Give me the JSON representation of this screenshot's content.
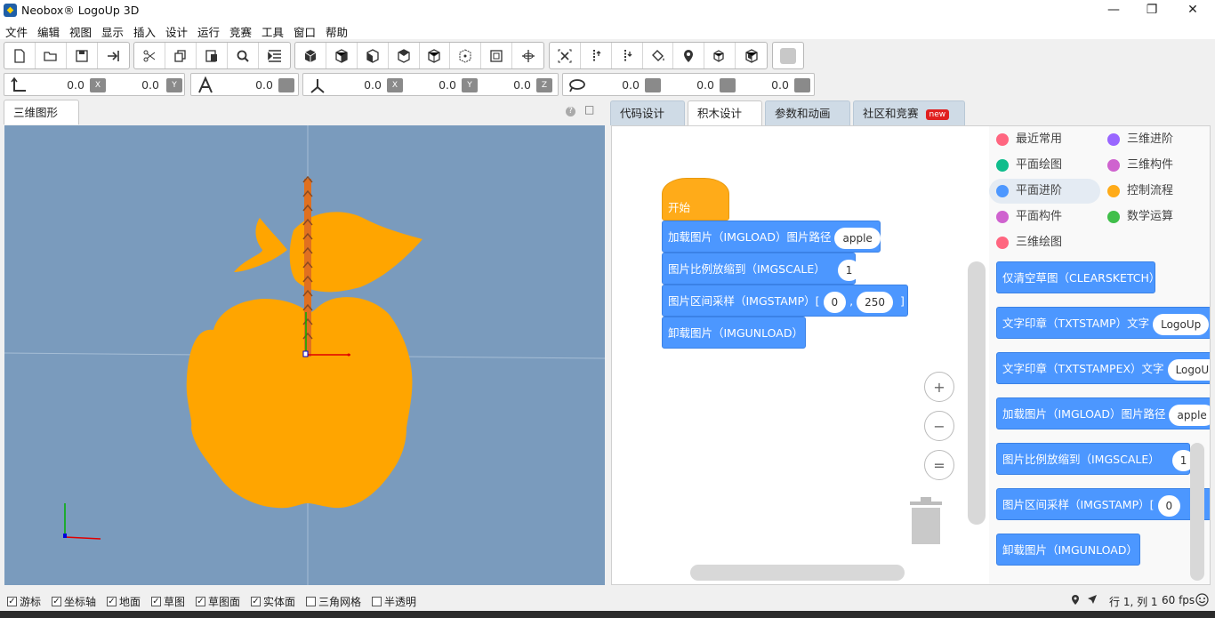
{
  "window": {
    "title": "Neobox® LogoUp 3D",
    "minimize": "—",
    "maximize": "❐",
    "close": "✕"
  },
  "menu": [
    "文件",
    "编辑",
    "视图",
    "显示",
    "插入",
    "设计",
    "运行",
    "竞赛",
    "工具",
    "窗口",
    "帮助"
  ],
  "coords": {
    "pos_x": "0.0",
    "pos_y": "0.0",
    "angle": "0.0",
    "rot_x": "0.0",
    "rot_y": "0.0",
    "rot_z": "0.0",
    "s1": "0.0",
    "s2": "0.0",
    "s3": "0.0"
  },
  "coord_icon_labels": {
    "x": "X",
    "y": "Y",
    "z": "Z"
  },
  "left_tab": "三维图形",
  "left_tab_help": "?",
  "left_tab_max": "□",
  "right_tabs": [
    "代码设计",
    "积木设计",
    "参数和动画",
    "社区和竞赛"
  ],
  "new_badge": "new",
  "workspace_blocks": {
    "start": "开始",
    "imgload": "加载图片（IMGLOAD）图片路径",
    "imgload_val": "apple",
    "imgscale": "图片比例放缩到（IMGSCALE）",
    "imgscale_val": "1",
    "imgstamp": "图片区间采样（IMGSTAMP）[",
    "imgstamp_v1": "0",
    "imgstamp_comma": ",",
    "imgstamp_v2": "250",
    "imgstamp_end": "]",
    "imgunload": "卸载图片（IMGUNLOAD）"
  },
  "categories": [
    {
      "label": "最近常用",
      "color": "#ff6680"
    },
    {
      "label": "三维进阶",
      "color": "#9966ff"
    },
    {
      "label": "平面绘图",
      "color": "#0fbd8c"
    },
    {
      "label": "三维构件",
      "color": "#cf63cf"
    },
    {
      "label": "平面进阶",
      "color": "#4c97ff"
    },
    {
      "label": "控制流程",
      "color": "#ffab19"
    },
    {
      "label": "平面构件",
      "color": "#cf63cf"
    },
    {
      "label": "数学运算",
      "color": "#40bf4a"
    },
    {
      "label": "三维绘图",
      "color": "#ff6680"
    }
  ],
  "palette_blocks": {
    "clearsketch": "仅清空草图（CLEARSKETCH）",
    "txtstamp": "文字印章（TXTSTAMP）文字",
    "txtstamp_val": "LogoUp",
    "txtstampex": "文字印章（TXTSTAMPEX）文字",
    "txtstampex_val": "LogoUp",
    "imgload": "加载图片（IMGLOAD）图片路径",
    "imgload_val": "apple",
    "imgscale": "图片比例放缩到（IMGSCALE）",
    "imgscale_val": "1",
    "imgstamp": "图片区间采样（IMGSTAMP）[",
    "imgstamp_val": "0",
    "imgunload": "卸载图片（IMGUNLOAD）"
  },
  "zoom": {
    "in": "+",
    "out": "−",
    "reset": "="
  },
  "status_checks": [
    {
      "label": "游标",
      "checked": true
    },
    {
      "label": "坐标轴",
      "checked": true
    },
    {
      "label": "地面",
      "checked": true
    },
    {
      "label": "草图",
      "checked": true
    },
    {
      "label": "草图面",
      "checked": true
    },
    {
      "label": "实体面",
      "checked": true
    },
    {
      "label": "三角网格",
      "checked": false
    },
    {
      "label": "半透明",
      "checked": false
    }
  ],
  "status_right": {
    "position": "行 1, 列 1",
    "fps": "60 fps"
  },
  "colors": {
    "apple": "#ffa500",
    "viewport_bg": "#7a9bbd",
    "block_blue": "#4c97ff",
    "hat_orange": "#ffab19"
  }
}
